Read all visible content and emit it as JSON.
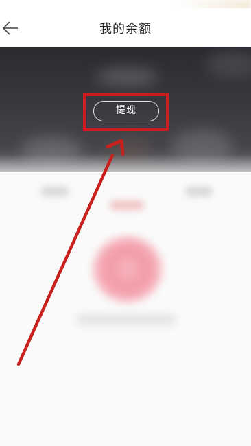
{
  "navbar": {
    "title": "我的余额",
    "back_icon": "arrow-left-icon"
  },
  "header": {
    "withdraw_label": "提现"
  },
  "annotation": {
    "highlight_color": "#c7201d",
    "arrow_color": "#c7201d"
  }
}
